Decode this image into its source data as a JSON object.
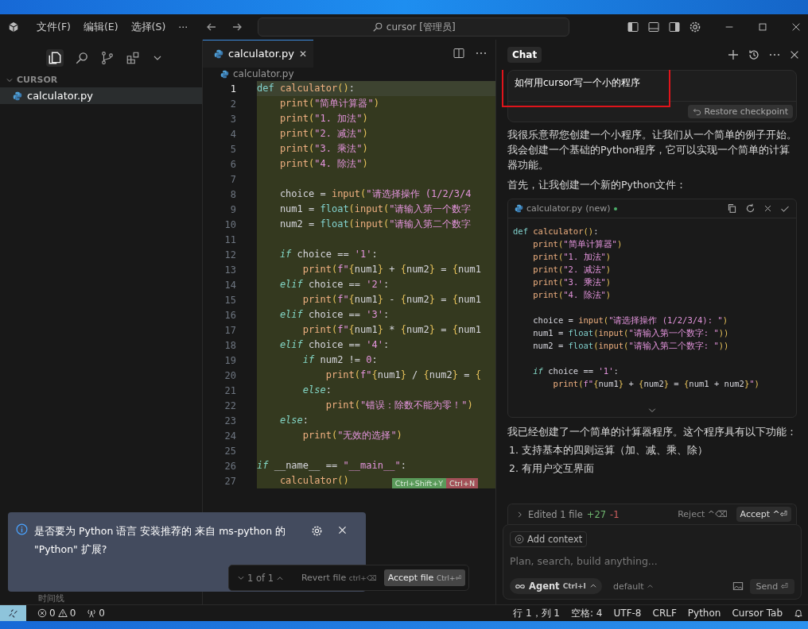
{
  "title_bar": {
    "menus": [
      "文件(F)",
      "编辑(E)",
      "选择(S)",
      "···"
    ],
    "search": {
      "value": "cursor [管理员]"
    }
  },
  "sidebar": {
    "section": {
      "title": "CURSOR",
      "expanded": true
    },
    "files": [
      {
        "name": "calculator.py",
        "selected": true
      }
    ],
    "bottom_section": "时间线"
  },
  "editor": {
    "tabs": [
      {
        "label": "calculator.py",
        "selected": true,
        "close": "✕"
      }
    ],
    "breadcrumb": "calculator.py",
    "lines": [
      {
        "number": "1",
        "current": true,
        "tokens": [
          {
            "kind": "kw",
            "text": "def"
          },
          {
            "kind": "fn",
            "text": " calculator"
          },
          {
            "kind": "br",
            "text": "()"
          },
          {
            "kind": "p",
            "text": ":"
          }
        ]
      },
      {
        "number": "2",
        "current": false,
        "tokens": [
          {
            "kind": "fn",
            "text": "    print"
          },
          {
            "kind": "br",
            "text": "("
          },
          {
            "kind": "str",
            "text": "\"简单计算器\""
          },
          {
            "kind": "br",
            "text": ")"
          }
        ]
      },
      {
        "number": "3",
        "current": false,
        "tokens": [
          {
            "kind": "fn",
            "text": "    print"
          },
          {
            "kind": "br",
            "text": "("
          },
          {
            "kind": "str",
            "text": "\"1. 加法\""
          },
          {
            "kind": "br",
            "text": ")"
          }
        ]
      },
      {
        "number": "4",
        "current": false,
        "tokens": [
          {
            "kind": "fn",
            "text": "    print"
          },
          {
            "kind": "br",
            "text": "("
          },
          {
            "kind": "str",
            "text": "\"2. 减法\""
          },
          {
            "kind": "br",
            "text": ")"
          }
        ]
      },
      {
        "number": "5",
        "current": false,
        "tokens": [
          {
            "kind": "fn",
            "text": "    print"
          },
          {
            "kind": "br",
            "text": "("
          },
          {
            "kind": "str",
            "text": "\"3. 乘法\""
          },
          {
            "kind": "br",
            "text": ")"
          }
        ]
      },
      {
        "number": "6",
        "current": false,
        "tokens": [
          {
            "kind": "fn",
            "text": "    print"
          },
          {
            "kind": "br",
            "text": "("
          },
          {
            "kind": "str",
            "text": "\"4. 除法\""
          },
          {
            "kind": "br",
            "text": ")"
          }
        ]
      },
      {
        "number": "7",
        "current": false
      },
      {
        "number": "8",
        "current": false,
        "tokens": [
          {
            "kind": "p",
            "text": "    choice = "
          },
          {
            "kind": "fn",
            "text": "input"
          },
          {
            "kind": "br",
            "text": "("
          },
          {
            "kind": "str",
            "text": "\"请选择操作 (1/2/3/4"
          }
        ]
      },
      {
        "number": "9",
        "current": false,
        "tokens": [
          {
            "kind": "p",
            "text": "    num1 = "
          },
          {
            "kind": "bi",
            "text": "float"
          },
          {
            "kind": "br",
            "text": "("
          },
          {
            "kind": "fn",
            "text": "input"
          },
          {
            "kind": "br",
            "text": "("
          },
          {
            "kind": "str",
            "text": "\"请输入第一个数字"
          }
        ]
      },
      {
        "number": "10",
        "current": false,
        "tokens": [
          {
            "kind": "p",
            "text": "    num2 = "
          },
          {
            "kind": "bi",
            "text": "float"
          },
          {
            "kind": "br",
            "text": "("
          },
          {
            "kind": "fn",
            "text": "input"
          },
          {
            "kind": "br",
            "text": "("
          },
          {
            "kind": "str",
            "text": "\"请输入第二个数字"
          }
        ]
      },
      {
        "number": "11",
        "current": false
      },
      {
        "number": "12",
        "current": false,
        "tokens": [
          {
            "kind": "ctl",
            "text": "    if"
          },
          {
            "kind": "p",
            "text": " choice == "
          },
          {
            "kind": "str",
            "text": "'1'"
          },
          {
            "kind": "p",
            "text": ":"
          }
        ]
      },
      {
        "number": "13",
        "current": false,
        "tokens": [
          {
            "kind": "fn",
            "text": "        print"
          },
          {
            "kind": "br",
            "text": "("
          },
          {
            "kind": "str",
            "text": "f\""
          },
          {
            "kind": "br",
            "text": "{"
          },
          {
            "kind": "p",
            "text": "num1"
          },
          {
            "kind": "br",
            "text": "}"
          },
          {
            "kind": "p",
            "text": " + "
          },
          {
            "kind": "br",
            "text": "{"
          },
          {
            "kind": "p",
            "text": "num2"
          },
          {
            "kind": "br",
            "text": "}"
          },
          {
            "kind": "p",
            "text": " = "
          },
          {
            "kind": "br",
            "text": "{"
          },
          {
            "kind": "p",
            "text": "num1"
          }
        ]
      },
      {
        "number": "14",
        "current": false,
        "tokens": [
          {
            "kind": "ctl",
            "text": "    elif"
          },
          {
            "kind": "p",
            "text": " choice == "
          },
          {
            "kind": "str",
            "text": "'2'"
          },
          {
            "kind": "p",
            "text": ":"
          }
        ]
      },
      {
        "number": "15",
        "current": false,
        "tokens": [
          {
            "kind": "fn",
            "text": "        print"
          },
          {
            "kind": "br",
            "text": "("
          },
          {
            "kind": "str",
            "text": "f\""
          },
          {
            "kind": "br",
            "text": "{"
          },
          {
            "kind": "p",
            "text": "num1"
          },
          {
            "kind": "br",
            "text": "}"
          },
          {
            "kind": "p",
            "text": " - "
          },
          {
            "kind": "br",
            "text": "{"
          },
          {
            "kind": "p",
            "text": "num2"
          },
          {
            "kind": "br",
            "text": "}"
          },
          {
            "kind": "p",
            "text": " = "
          },
          {
            "kind": "br",
            "text": "{"
          },
          {
            "kind": "p",
            "text": "num1"
          }
        ]
      },
      {
        "number": "16",
        "current": false,
        "tokens": [
          {
            "kind": "ctl",
            "text": "    elif"
          },
          {
            "kind": "p",
            "text": " choice == "
          },
          {
            "kind": "str",
            "text": "'3'"
          },
          {
            "kind": "p",
            "text": ":"
          }
        ]
      },
      {
        "number": "17",
        "current": false,
        "tokens": [
          {
            "kind": "fn",
            "text": "        print"
          },
          {
            "kind": "br",
            "text": "("
          },
          {
            "kind": "str",
            "text": "f\""
          },
          {
            "kind": "br",
            "text": "{"
          },
          {
            "kind": "p",
            "text": "num1"
          },
          {
            "kind": "br",
            "text": "}"
          },
          {
            "kind": "p",
            "text": " * "
          },
          {
            "kind": "br",
            "text": "{"
          },
          {
            "kind": "p",
            "text": "num2"
          },
          {
            "kind": "br",
            "text": "}"
          },
          {
            "kind": "p",
            "text": " = "
          },
          {
            "kind": "br",
            "text": "{"
          },
          {
            "kind": "p",
            "text": "num1"
          }
        ]
      },
      {
        "number": "18",
        "current": false,
        "tokens": [
          {
            "kind": "ctl",
            "text": "    elif"
          },
          {
            "kind": "p",
            "text": " choice == "
          },
          {
            "kind": "str",
            "text": "'4'"
          },
          {
            "kind": "p",
            "text": ":"
          }
        ]
      },
      {
        "number": "19",
        "current": false,
        "tokens": [
          {
            "kind": "ctl",
            "text": "        if"
          },
          {
            "kind": "p",
            "text": " num2 != "
          },
          {
            "kind": "num",
            "text": "0"
          },
          {
            "kind": "p",
            "text": ":"
          }
        ]
      },
      {
        "number": "20",
        "current": false,
        "tokens": [
          {
            "kind": "fn",
            "text": "            print"
          },
          {
            "kind": "br",
            "text": "("
          },
          {
            "kind": "str",
            "text": "f\""
          },
          {
            "kind": "br",
            "text": "{"
          },
          {
            "kind": "p",
            "text": "num1"
          },
          {
            "kind": "br",
            "text": "}"
          },
          {
            "kind": "p",
            "text": " / "
          },
          {
            "kind": "br",
            "text": "{"
          },
          {
            "kind": "p",
            "text": "num2"
          },
          {
            "kind": "br",
            "text": "}"
          },
          {
            "kind": "p",
            "text": " = "
          },
          {
            "kind": "br",
            "text": "{"
          }
        ]
      },
      {
        "number": "21",
        "current": false,
        "tokens": [
          {
            "kind": "ctl",
            "text": "        else"
          },
          {
            "kind": "p",
            "text": ":"
          }
        ]
      },
      {
        "number": "22",
        "current": false,
        "tokens": [
          {
            "kind": "fn",
            "text": "            print"
          },
          {
            "kind": "br",
            "text": "("
          },
          {
            "kind": "str",
            "text": "\"错误：除数不能为零！\""
          },
          {
            "kind": "br",
            "text": ")"
          }
        ]
      },
      {
        "number": "23",
        "current": false,
        "tokens": [
          {
            "kind": "ctl",
            "text": "    else"
          },
          {
            "kind": "p",
            "text": ":"
          }
        ]
      },
      {
        "number": "24",
        "current": false,
        "tokens": [
          {
            "kind": "fn",
            "text": "        print"
          },
          {
            "kind": "br",
            "text": "("
          },
          {
            "kind": "str",
            "text": "\"无效的选择\""
          },
          {
            "kind": "br",
            "text": ")"
          }
        ]
      },
      {
        "number": "25",
        "current": false
      },
      {
        "number": "26",
        "current": false,
        "tokens": [
          {
            "kind": "ctl",
            "text": "if"
          },
          {
            "kind": "p",
            "text": " __name__ == "
          },
          {
            "kind": "str",
            "text": "\"__main__\""
          },
          {
            "kind": "p",
            "text": ":"
          }
        ]
      },
      {
        "number": "27",
        "current": false,
        "tokens": [
          {
            "kind": "fn",
            "text": "    calculator"
          },
          {
            "kind": "br",
            "text": "()"
          }
        ]
      }
    ],
    "inline_hints": [
      {
        "label": "Ctrl+Shift+Y",
        "kind": "accept"
      },
      {
        "label": "Ctrl+N",
        "kind": "reject"
      }
    ],
    "review_bar": {
      "counter": "1 of 1",
      "revert": "Revert file",
      "revert_shortcut": "ctrl+⌫",
      "accept": "Accept file",
      "accept_shortcut": "Ctrl+⏎"
    }
  },
  "chat": {
    "tab": "Chat",
    "user_message": "如何用cursor写一个小的程序",
    "restore": "Restore checkpoint",
    "paragraphs": [
      "我很乐意帮您创建一个小程序。让我们从一个简单的例子开始。我会创建一个基础的Python程序，它可以实现一个简单的计算器功能。",
      "首先，让我创建一个新的Python文件："
    ],
    "code_block": {
      "file": "calculator.py",
      "badge": "(new)",
      "groups": [
        [
          [
            {
              "kind": "kw",
              "text": "def"
            },
            {
              "kind": "fn",
              "text": " calculator"
            },
            {
              "kind": "br",
              "text": "()"
            },
            {
              "kind": "p",
              "text": ":"
            }
          ],
          [
            {
              "kind": "fn",
              "text": "    print"
            },
            {
              "kind": "br",
              "text": "("
            },
            {
              "kind": "str",
              "text": "\"简单计算器\""
            },
            {
              "kind": "br",
              "text": ")"
            }
          ],
          [
            {
              "kind": "fn",
              "text": "    print"
            },
            {
              "kind": "br",
              "text": "("
            },
            {
              "kind": "str",
              "text": "\"1. 加法\""
            },
            {
              "kind": "br",
              "text": ")"
            }
          ],
          [
            {
              "kind": "fn",
              "text": "    print"
            },
            {
              "kind": "br",
              "text": "("
            },
            {
              "kind": "str",
              "text": "\"2. 减法\""
            },
            {
              "kind": "br",
              "text": ")"
            }
          ],
          [
            {
              "kind": "fn",
              "text": "    print"
            },
            {
              "kind": "br",
              "text": "("
            },
            {
              "kind": "str",
              "text": "\"3. 乘法\""
            },
            {
              "kind": "br",
              "text": ")"
            }
          ],
          [
            {
              "kind": "fn",
              "text": "    print"
            },
            {
              "kind": "br",
              "text": "("
            },
            {
              "kind": "str",
              "text": "\"4. 除法\""
            },
            {
              "kind": "br",
              "text": ")"
            }
          ]
        ],
        [
          [
            {
              "kind": "p",
              "text": "    choice = "
            },
            {
              "kind": "fn",
              "text": "input"
            },
            {
              "kind": "br",
              "text": "("
            },
            {
              "kind": "str",
              "text": "\"请选择操作 (1/2/3/4): \""
            },
            {
              "kind": "br",
              "text": ")"
            }
          ],
          [
            {
              "kind": "p",
              "text": "    num1 = "
            },
            {
              "kind": "bi",
              "text": "float"
            },
            {
              "kind": "br",
              "text": "("
            },
            {
              "kind": "fn",
              "text": "input"
            },
            {
              "kind": "br",
              "text": "("
            },
            {
              "kind": "str",
              "text": "\"请输入第一个数字: \""
            },
            {
              "kind": "br",
              "text": "))"
            }
          ],
          [
            {
              "kind": "p",
              "text": "    num2 = "
            },
            {
              "kind": "bi",
              "text": "float"
            },
            {
              "kind": "br",
              "text": "("
            },
            {
              "kind": "fn",
              "text": "input"
            },
            {
              "kind": "br",
              "text": "("
            },
            {
              "kind": "str",
              "text": "\"请输入第二个数字: \""
            },
            {
              "kind": "br",
              "text": "))"
            }
          ]
        ],
        [
          [
            {
              "kind": "ctl",
              "text": "    if"
            },
            {
              "kind": "p",
              "text": " choice == "
            },
            {
              "kind": "str",
              "text": "'1'"
            },
            {
              "kind": "p",
              "text": ":"
            }
          ],
          [
            {
              "kind": "fn",
              "text": "        print"
            },
            {
              "kind": "br",
              "text": "("
            },
            {
              "kind": "str",
              "text": "f\""
            },
            {
              "kind": "br",
              "text": "{"
            },
            {
              "kind": "p",
              "text": "num1"
            },
            {
              "kind": "br",
              "text": "}"
            },
            {
              "kind": "p",
              "text": " + "
            },
            {
              "kind": "br",
              "text": "{"
            },
            {
              "kind": "p",
              "text": "num2"
            },
            {
              "kind": "br",
              "text": "}"
            },
            {
              "kind": "p",
              "text": " = "
            },
            {
              "kind": "br",
              "text": "{"
            },
            {
              "kind": "p",
              "text": "num1 + num2"
            },
            {
              "kind": "br",
              "text": "}"
            },
            {
              "kind": "str",
              "text": "\""
            },
            {
              "kind": "br",
              "text": ")"
            }
          ]
        ]
      ]
    },
    "summary": "我已经创建了一个简单的计算器程序。这个程序具有以下功能：",
    "features": [
      "1. 支持基本的四则运算（加、减、乘、除）",
      "2. 有用户交互界面"
    ],
    "edits": {
      "label": "Edited 1 file",
      "added": "+27",
      "removed": "-1",
      "reject": "Reject ^⌫",
      "accept": "Accept ^⏎"
    },
    "composer": {
      "add_context": "Add context",
      "placeholder": "Plan, search, build anything...",
      "mode": "Agent",
      "mode_shortcut": "Ctrl+I",
      "model": "default",
      "send": "Send ⏎"
    }
  },
  "notification": {
    "message": "是否要为 Python 语言 安装推荐的 来自 ms-python 的 \"Python\" 扩展?"
  },
  "status_bar": {
    "errors": "0",
    "warnings": "0",
    "ports": "0",
    "items": [
      "行 1，列 1",
      "空格: 4",
      "UTF-8",
      "CRLF",
      "Python",
      "Cursor Tab"
    ]
  }
}
